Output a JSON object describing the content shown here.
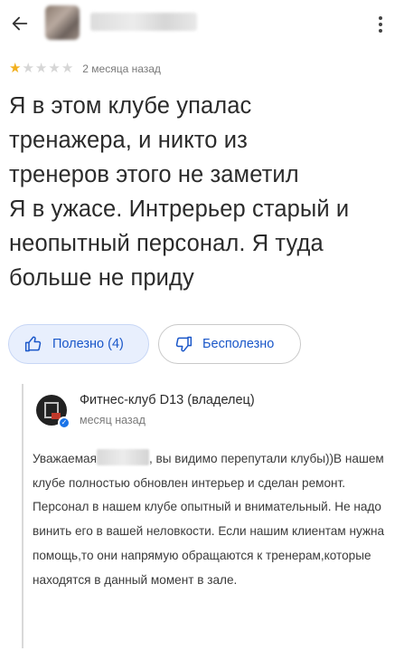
{
  "header": {
    "back_icon": "arrow-left-icon",
    "more_icon": "more-vert-icon"
  },
  "review": {
    "rating": 1,
    "max_rating": 5,
    "star_color": "#f2b01e",
    "time": "2 месяца назад",
    "text": "Я в этом  клубе упалас\nтренажера, и никто из\nтренеров этого не заметил\nЯ в ужасе. Интрерьер старый и\nнеопытный персонал. Я туда\nбольше не приду"
  },
  "actions": {
    "useful_label": "Полезно (4)",
    "useless_label": "Бесполезно",
    "accent_color": "#1a57c9"
  },
  "owner_reply": {
    "name": "Фитнес-клуб D13 (владелец)",
    "time": "месяц назад",
    "text_before_redaction": "Уважаемая",
    "text_after_redaction": ", вы видимо перепутали клубы))В нашем клубе полностью обновлен интерьер и сделан ремонт. Персонал в нашем клубе опытный и внимательный. Не надо винить его в вашей неловкости. Если нашим клиентам нужна помощь,то они напрямую обращаются к тренерам,которые находятся в данный момент в зале."
  }
}
